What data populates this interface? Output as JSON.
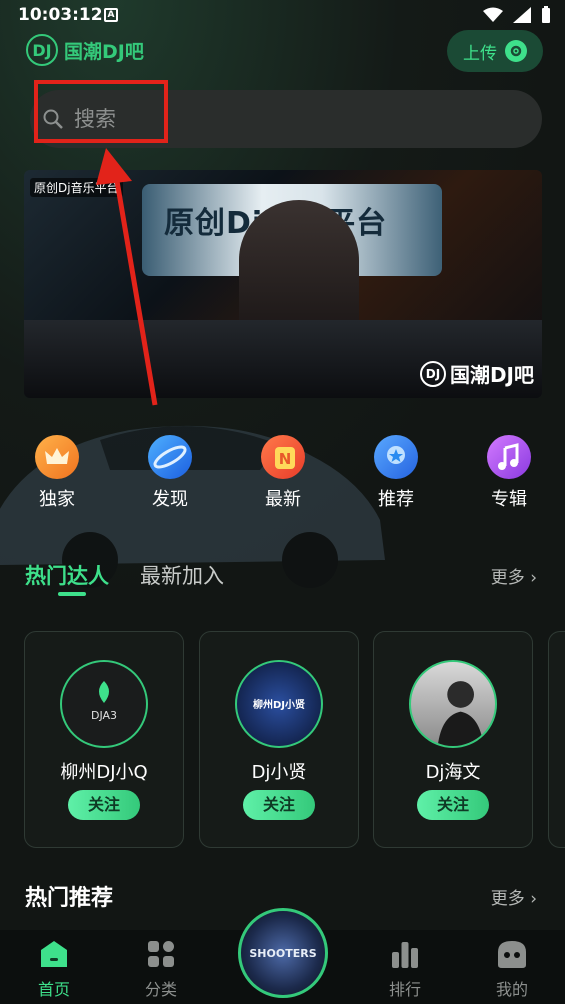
{
  "status_bar": {
    "time": "10:03:12",
    "notif_badge": "A"
  },
  "header": {
    "logo_text": "国潮DJ吧",
    "upload_label": "上传"
  },
  "search": {
    "placeholder": "搜索"
  },
  "banner": {
    "tag": "原创Dj音乐平台",
    "headline": "原创Dj音乐平台",
    "watermark": "国潮DJ吧"
  },
  "categories": [
    {
      "label": "独家",
      "icon": "crown-icon",
      "color": "#f08a2c"
    },
    {
      "label": "发现",
      "icon": "planet-icon",
      "color": "#2d86f0"
    },
    {
      "label": "最新",
      "icon": "new-badge-icon",
      "color": "#f05a3a"
    },
    {
      "label": "推荐",
      "icon": "medal-icon",
      "color": "#2f7af0"
    },
    {
      "label": "专辑",
      "icon": "music-note-icon",
      "color": "#b05af0"
    }
  ],
  "tabs": {
    "active": "热门达人",
    "inactive": "最新加入",
    "more": "更多"
  },
  "artists": [
    {
      "name": "柳州DJ小Q",
      "avatar_text": "DJA3",
      "follow": "关注"
    },
    {
      "name": "Dj小贤",
      "avatar_text": "柳州DJ小贤",
      "follow": "关注"
    },
    {
      "name": "Dj海文",
      "avatar_text": "",
      "follow": "关注"
    }
  ],
  "hot_recommend": {
    "title": "热门推荐",
    "more": "更多"
  },
  "bottom_nav": {
    "home": "首页",
    "category": "分类",
    "ranking": "排行",
    "mine": "我的",
    "center_disc_text": "SHOOTERS"
  },
  "colors": {
    "accent": "#3ee08b",
    "annotation_red": "#e2231a"
  }
}
